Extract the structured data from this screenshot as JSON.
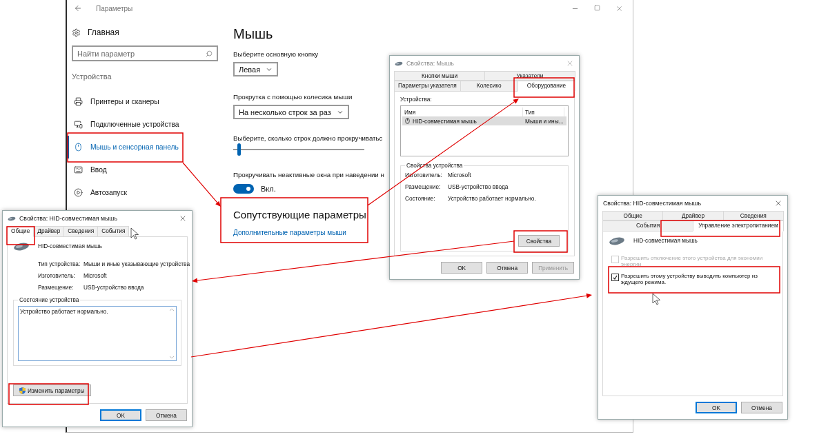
{
  "settings_window": {
    "title": "Параметры",
    "home": "Главная",
    "search": {
      "placeholder": "Найти параметр"
    },
    "section": "Устройства",
    "nav": [
      {
        "label": "Принтеры и сканеры",
        "selected": false
      },
      {
        "label": "Подключенные устройства",
        "selected": false
      },
      {
        "label": "Мышь и сенсорная панель",
        "selected": true
      },
      {
        "label": "Ввод",
        "selected": false
      },
      {
        "label": "Автозапуск",
        "selected": false
      }
    ],
    "page": {
      "title": "Мышь",
      "primary_button": {
        "label": "Выберите основную кнопку",
        "value": "Левая"
      },
      "wheel": {
        "label": "Прокрутка с помощью колесика мыши",
        "value": "На несколько строк за раз"
      },
      "lines": {
        "label": "Выберите, сколько строк должно прокручиватьс",
        "level": 0.03
      },
      "inactive_scroll": {
        "label": "Прокручивать неактивные окна при наведении н",
        "on": true,
        "state_label": "Вкл."
      },
      "related": {
        "title": "Сопутствующие параметры",
        "link": "Дополнительные параметры мыши"
      }
    }
  },
  "mouse_dialog": {
    "title": "Свойства: Мышь",
    "tab_rows": [
      [
        {
          "label": "Кнопки мыши",
          "selected": false
        },
        {
          "label": "Указатели",
          "selected": false
        }
      ],
      [
        {
          "label": "Параметры указателя",
          "selected": false
        },
        {
          "label": "Колесико",
          "selected": false
        },
        {
          "label": "Оборудование",
          "selected": true
        }
      ]
    ],
    "devices_label": "Устройства:",
    "columns": [
      "Имя",
      "Тип"
    ],
    "rows": [
      {
        "name": "HID-совместимая мышь",
        "type": "Мыши и ины...",
        "selected": true
      }
    ],
    "group_title": "Свойства устройства",
    "props": [
      {
        "label": "Изготовитель:",
        "value": "Microsoft"
      },
      {
        "label": "Размещение:",
        "value": "USB-устройство ввода"
      },
      {
        "label": "Состояние:",
        "value": "Устройство работает нормально."
      }
    ],
    "properties_button": "Свойства",
    "buttons": [
      {
        "label": "OK",
        "default": false,
        "disabled": false
      },
      {
        "label": "Отмена",
        "default": false,
        "disabled": false
      },
      {
        "label": "Применить",
        "default": false,
        "disabled": true
      }
    ]
  },
  "general_dialog": {
    "title": "Свойства: HID-совместимая мышь",
    "tabs": [
      {
        "label": "Общие",
        "selected": true
      },
      {
        "label": "Драйвер",
        "selected": false
      },
      {
        "label": "Сведения",
        "selected": false
      },
      {
        "label": "События",
        "selected": false
      }
    ],
    "device_name": "HID-совместимая мышь",
    "props": [
      {
        "label": "Тип устройства:",
        "value": "Мыши и иные указывающие устройства"
      },
      {
        "label": "Изготовитель:",
        "value": "Microsoft"
      },
      {
        "label": "Размещение:",
        "value": "USB-устройство ввода"
      }
    ],
    "status_title": "Состояние устройства",
    "status_text": "Устройство работает нормально.",
    "change_button": "Изменить параметры",
    "buttons": [
      {
        "label": "OK",
        "default": true,
        "disabled": false
      },
      {
        "label": "Отмена",
        "default": false,
        "disabled": false
      }
    ]
  },
  "power_dialog": {
    "title": "Свойства: HID-совместимая мышь",
    "tab_rows": [
      [
        {
          "label": "Общие",
          "selected": false
        },
        {
          "label": "Драйвер",
          "selected": false
        },
        {
          "label": "Сведения",
          "selected": false
        }
      ],
      [
        {
          "label": "События",
          "selected": false
        },
        {
          "label": "Управление электропитанием",
          "selected": true
        }
      ]
    ],
    "device_name": "HID-совместимая мышь",
    "options": [
      {
        "label": "Разрешить отключение этого устройства для экономии энергии",
        "checked": false,
        "disabled": true
      },
      {
        "label": "Разрешить этому устройству выводить компьютер из ждущего режима.",
        "checked": true,
        "disabled": false
      }
    ],
    "buttons": [
      {
        "label": "OK",
        "default": true,
        "disabled": false
      },
      {
        "label": "Отмена",
        "default": false,
        "disabled": false
      }
    ]
  }
}
